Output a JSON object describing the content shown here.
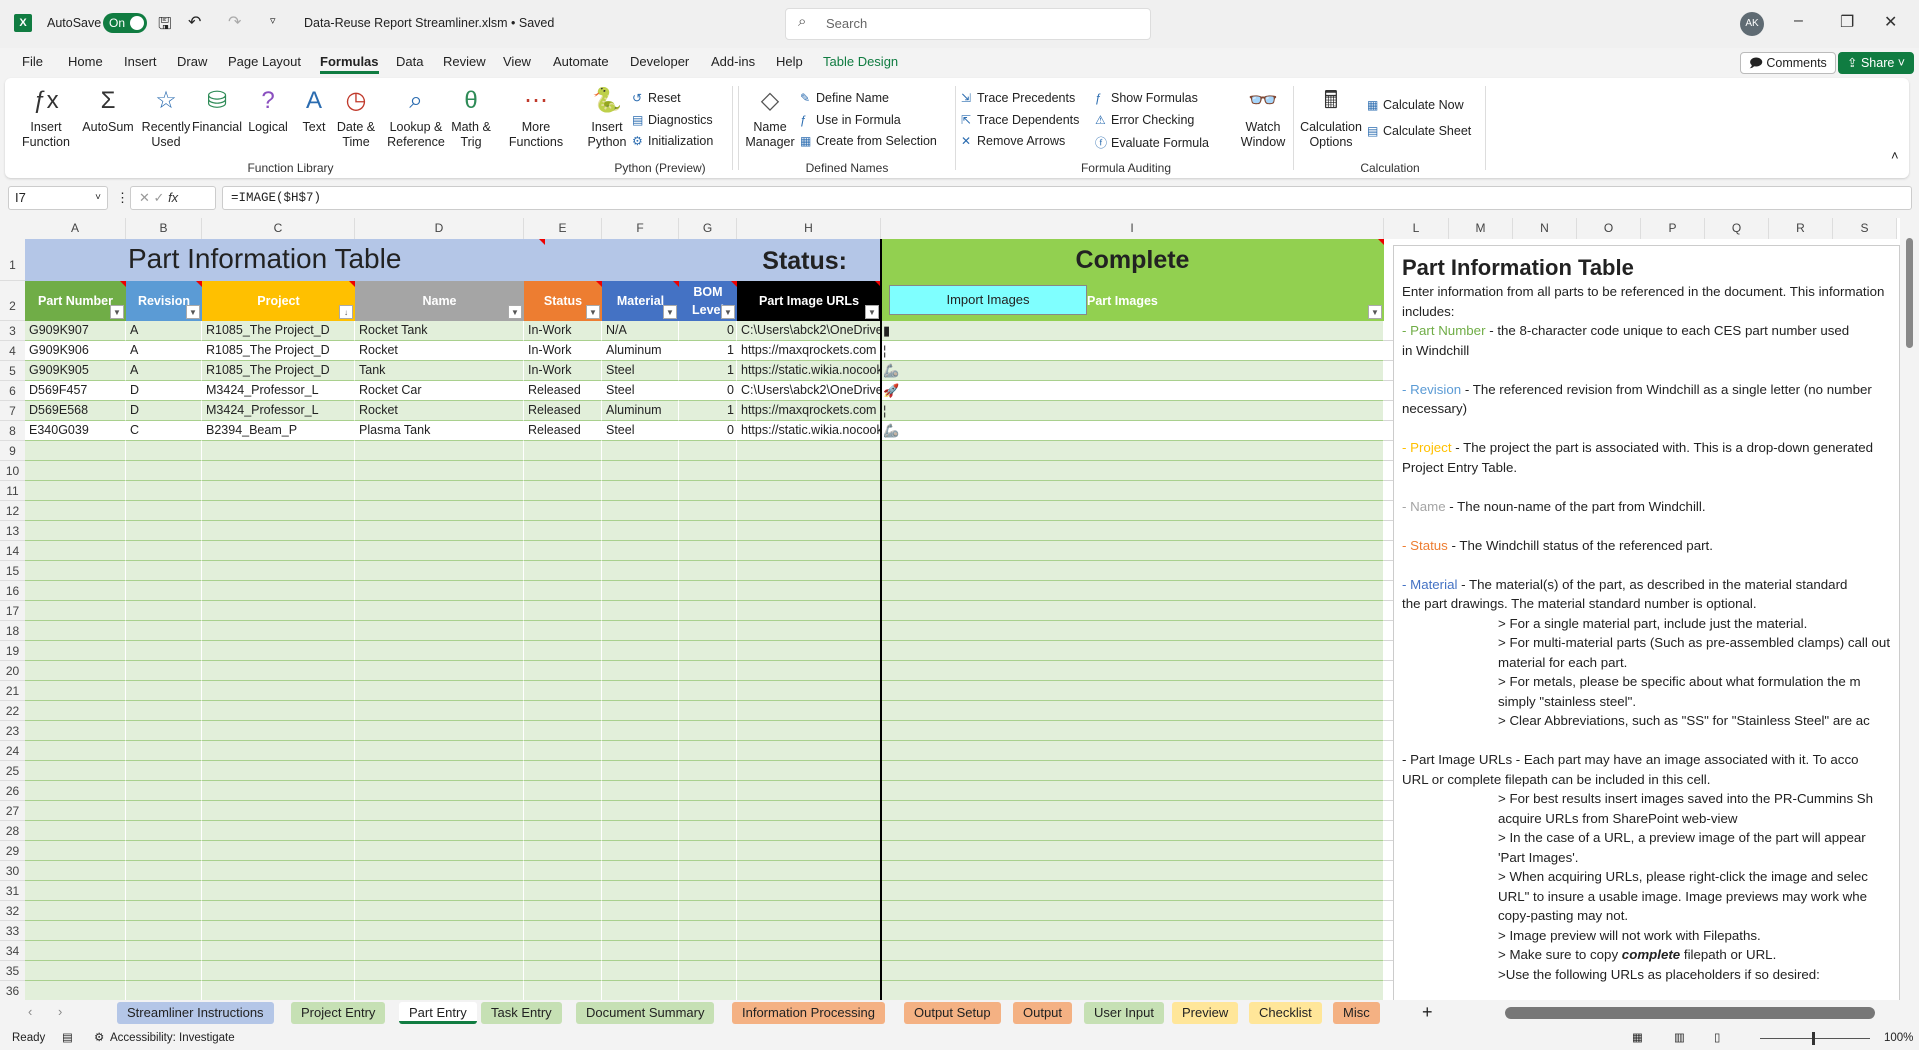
{
  "app": {
    "autosave_label": "AutoSave",
    "autosave_state": "On",
    "file_title": "Data-Reuse Report Streamliner.xlsm • Saved",
    "search_placeholder": "Search",
    "user_initials": "AK",
    "comments": "Comments",
    "share": "Share"
  },
  "menu": [
    "File",
    "Home",
    "Insert",
    "Draw",
    "Page Layout",
    "Formulas",
    "Data",
    "Review",
    "View",
    "Automate",
    "Developer",
    "Add-ins",
    "Help",
    "Table Design"
  ],
  "ribbon": {
    "function_library": {
      "label": "Function Library",
      "buttons": [
        "Insert\nFunction",
        "AutoSum",
        "Recently\nUsed",
        "Financial",
        "Logical",
        "Text",
        "Date &\nTime",
        "Lookup &\nReference",
        "Math &\nTrig",
        "More\nFunctions"
      ]
    },
    "python": {
      "label": "Python (Preview)",
      "insert": "Insert\nPython",
      "items": [
        "Reset",
        "Diagnostics",
        "Initialization"
      ]
    },
    "defined_names": {
      "label": "Defined Names",
      "manager": "Name\nManager",
      "items": [
        "Define Name",
        "Use in Formula",
        "Create from Selection"
      ]
    },
    "formula_auditing": {
      "label": "Formula Auditing",
      "items": [
        "Trace Precedents",
        "Trace Dependents",
        "Remove Arrows",
        "Show Formulas",
        "Error Checking",
        "Evaluate Formula"
      ],
      "watch": "Watch\nWindow"
    },
    "calculation": {
      "label": "Calculation",
      "options": "Calculation\nOptions",
      "items": [
        "Calculate Now",
        "Calculate Sheet"
      ]
    }
  },
  "formula_bar": {
    "name_box": "I7",
    "formula": "=IMAGE($H$7)"
  },
  "columns": [
    "A",
    "B",
    "C",
    "D",
    "E",
    "F",
    "G",
    "H",
    "I",
    "L",
    "M",
    "N",
    "O",
    "P",
    "Q",
    "R",
    "S"
  ],
  "row_numbers": [
    "1",
    "2",
    "3",
    "4",
    "5",
    "6",
    "7",
    "8",
    "9",
    "10",
    "11",
    "12",
    "13",
    "14",
    "15",
    "16",
    "17",
    "18",
    "19",
    "20",
    "21",
    "22",
    "23",
    "24",
    "25",
    "26",
    "27",
    "28",
    "29",
    "30",
    "31",
    "32",
    "33",
    "34",
    "35",
    "36"
  ],
  "table": {
    "title": "Part Information Table",
    "status_label": "Status:",
    "status_value": "Complete",
    "import_button": "Import Images",
    "headers": [
      {
        "label": "Part Number",
        "color": "#70ad47"
      },
      {
        "label": "Revision",
        "color": "#5b9bd5"
      },
      {
        "label": "Project",
        "color": "#ffc000"
      },
      {
        "label": "Name",
        "color": "#a5a5a5"
      },
      {
        "label": "Status",
        "color": "#ed7d31"
      },
      {
        "label": "Material",
        "color": "#4472c4"
      },
      {
        "label": "BOM Level",
        "color": "#4472c4"
      },
      {
        "label": "Part Image URLs",
        "color": "#000000"
      },
      {
        "label": "Part Images",
        "color": "#92d050"
      }
    ],
    "rows": [
      [
        "G909K907",
        "A",
        "R1085_The Project_D",
        "Rocket Tank",
        "In-Work",
        "N/A",
        "0",
        "C:\\Users\\abck2\\OneDrive"
      ],
      [
        "G909K906",
        "A",
        "R1085_The Project_D",
        "Rocket",
        "In-Work",
        "Aluminum",
        "1",
        "https://maxqrockets.com"
      ],
      [
        "G909K905",
        "A",
        "R1085_The Project_D",
        "Tank",
        "In-Work",
        "Steel",
        "1",
        "https://static.wikia.nocookie.net"
      ],
      [
        "D569F457",
        "D",
        "M3424_Professor_L",
        "Rocket Car",
        "Released",
        "Steel",
        "0",
        "C:\\Users\\abck2\\OneDrive"
      ],
      [
        "D569E568",
        "D",
        "M3424_Professor_L",
        "Rocket",
        "Released",
        "Aluminum",
        "1",
        "https://maxqrockets.com"
      ],
      [
        "E340G039",
        "C",
        "B2394_Beam_P",
        "Plasma Tank",
        "Released",
        "Steel",
        "0",
        "https://static.wikia.nocookie.net"
      ]
    ]
  },
  "panel": {
    "title": "Part Information Table",
    "intro": "Enter information from all parts to be referenced in the document. This information",
    "intro2": "includes:",
    "items": [
      {
        "term": "Part Number",
        "color": "#70ad47",
        "text": " - the 8-character code unique to each CES part number used",
        "cont": "in Windchill"
      },
      {
        "term": "Revision",
        "color": "#5b9bd5",
        "text": " - The referenced revision from Windchill as a single letter (no number",
        "cont": "necessary)"
      },
      {
        "term": "Project",
        "color": "#ffc000",
        "text": " - The project the part is associated with. This is a drop-down generated",
        "cont": "Project Entry Table."
      },
      {
        "term": "Name",
        "color": "#a5a5a5",
        "text": " - The noun-name of the part from Windchill.",
        "cont": ""
      },
      {
        "term": "Status",
        "color": "#ed7d31",
        "text": " - The Windchill status of the referenced part.",
        "cont": ""
      },
      {
        "term": "Material",
        "color": "#4472c4",
        "text": " - The material(s) of the part, as described in the material standard",
        "cont": "the part drawings. The material standard number is optional."
      }
    ],
    "material_notes": [
      "> For a single material part, include just the material.",
      "> For multi-material parts (Such as pre-assembled clamps) call out",
      "material for each part.",
      "> For metals, please be specific about what formulation the m",
      "simply \"stainless steel\".",
      "> Clear Abbreviations, such as \"SS\" for \"Stainless Steel\" are ac"
    ],
    "url_heading": " - Part Image URLs - Each part may have an  image associated with it. To acco",
    "url_heading2": "URL or complete filepath can be included in this cell.",
    "url_notes": [
      "> For best results insert images saved into the PR-Cummins Sh",
      "acquire URLs from SharePoint web-view",
      "> In the case of a URL, a preview image of the part will appear",
      "'Part Images'.",
      "> When acquiring URLs, please right-click the image and selec",
      "URL\" to insure a usable image. Image previews may work whe",
      "copy-pasting may not.",
      "> Image preview will not work with Filepaths."
    ],
    "copy_note_pre": "> Make sure to copy ",
    "copy_note_em": "complete",
    "copy_note_post": " filepath or URL.",
    "placeholder_note": ">Use the following URLs as placeholders if so desired:"
  },
  "sheet_tabs": [
    {
      "label": "Streamliner Instructions",
      "color": "#b4c6e7"
    },
    {
      "label": "Project Entry",
      "color": "#c6e0b4"
    },
    {
      "label": "Part Entry",
      "color": "#ffffff",
      "active": true
    },
    {
      "label": "Task Entry",
      "color": "#c6e0b4"
    },
    {
      "label": "Document Summary",
      "color": "#c6e0b4"
    },
    {
      "label": "Information Processing",
      "color": "#f4b183"
    },
    {
      "label": "Output Setup",
      "color": "#f4b183"
    },
    {
      "label": "Output",
      "color": "#f4b183"
    },
    {
      "label": "User Input",
      "color": "#c6e0b4"
    },
    {
      "label": "Preview",
      "color": "#ffe699"
    },
    {
      "label": "Checklist",
      "color": "#ffe699"
    },
    {
      "label": "Misc",
      "color": "#f4b183"
    }
  ],
  "status_bar": {
    "ready": "Ready",
    "accessibility": "Accessibility: Investigate",
    "zoom": "100%"
  }
}
